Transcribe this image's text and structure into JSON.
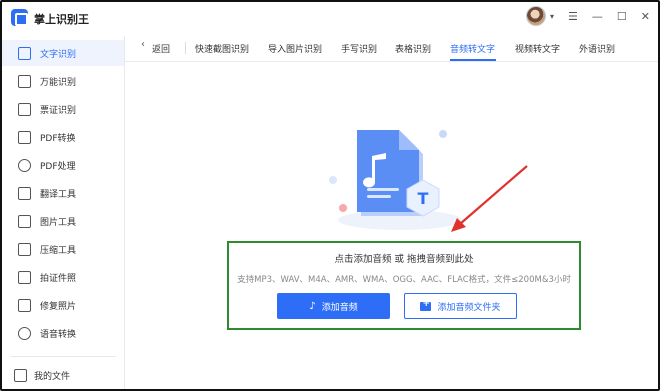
{
  "app": {
    "title": "掌上识别王"
  },
  "window": {
    "menu_icon": "menu-icon",
    "minimize_icon": "minimize-icon",
    "maximize_icon": "maximize-icon",
    "close_icon": "close-icon"
  },
  "sidebar": {
    "items": [
      {
        "label": "文字识别",
        "icon": "text-recognition-icon",
        "active": true
      },
      {
        "label": "万能识别",
        "icon": "universal-icon"
      },
      {
        "label": "票证识别",
        "icon": "ticket-icon"
      },
      {
        "label": "PDF转换",
        "icon": "pdf-convert-icon"
      },
      {
        "label": "PDF处理",
        "icon": "pdf-process-icon"
      },
      {
        "label": "翻译工具",
        "icon": "translate-icon"
      },
      {
        "label": "图片工具",
        "icon": "image-tool-icon"
      },
      {
        "label": "压缩工具",
        "icon": "compress-icon"
      },
      {
        "label": "拍证件照",
        "icon": "id-photo-icon"
      },
      {
        "label": "修复照片",
        "icon": "repair-photo-icon"
      },
      {
        "label": "语音转换",
        "icon": "voice-icon"
      }
    ],
    "my_files": "我的文件"
  },
  "tabs": {
    "back": "返回",
    "items": [
      {
        "label": "快速截图识别"
      },
      {
        "label": "导入图片识别"
      },
      {
        "label": "手写识别"
      },
      {
        "label": "表格识别"
      },
      {
        "label": "音频转文字",
        "active": true
      },
      {
        "label": "视频转文字"
      },
      {
        "label": "外语识别"
      }
    ]
  },
  "upload": {
    "title": "点击添加音频 或 拖拽音频到此处",
    "formats": "支持MP3、WAV、M4A、AMR、WMA、OGG、AAC、FLAC格式，文件≤200M&3小时",
    "add_audio_button": "添加音频",
    "add_folder_button": "添加音频文件夹"
  },
  "colors": {
    "accent": "#2e6ef7",
    "annotation_box": "#2d8a2d",
    "annotation_arrow": "#e0322d"
  }
}
